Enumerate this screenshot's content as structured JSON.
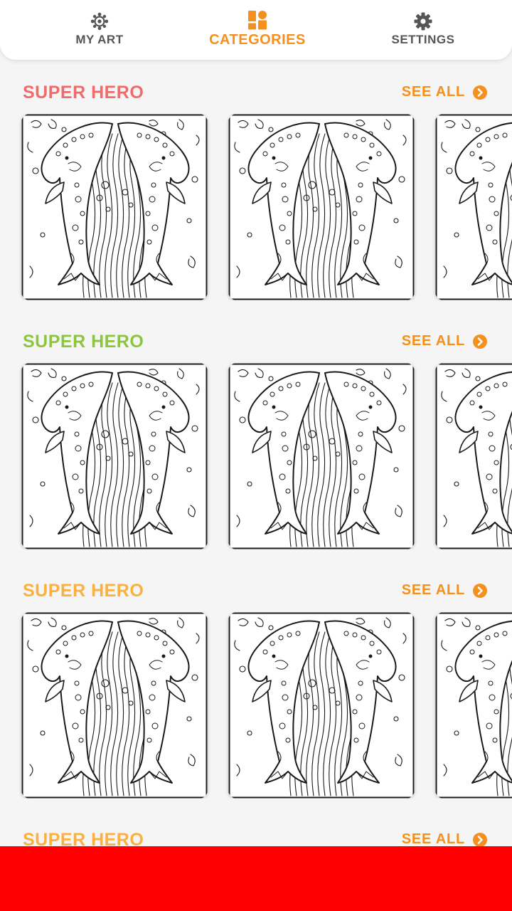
{
  "nav": {
    "tabs": [
      {
        "label": "MY ART",
        "icon": "my-art-icon",
        "active": false
      },
      {
        "label": "CATEGORIES",
        "icon": "categories-icon",
        "active": true
      },
      {
        "label": "SETTINGS",
        "icon": "gear-icon",
        "active": false
      }
    ]
  },
  "colors": {
    "accent": "#f5901e",
    "inactive": "#555555",
    "ad_banner": "#ff0000",
    "section_titles": [
      "#f26b6b",
      "#8cc63f",
      "#fbb040",
      "#fbb040"
    ]
  },
  "sections": [
    {
      "title": "SUPER HERO",
      "see_all": "SEE ALL",
      "cards": [
        "dolphin-coloring-page",
        "dolphin-coloring-page",
        "dolphin-coloring-page"
      ]
    },
    {
      "title": "SUPER HERO",
      "see_all": "SEE ALL",
      "cards": [
        "dolphin-coloring-page",
        "dolphin-coloring-page",
        "dolphin-coloring-page"
      ]
    },
    {
      "title": "SUPER HERO",
      "see_all": "SEE ALL",
      "cards": [
        "dolphin-coloring-page",
        "dolphin-coloring-page",
        "dolphin-coloring-page"
      ]
    },
    {
      "title": "SUPER HERO",
      "see_all": "SEE ALL",
      "cards": []
    }
  ]
}
